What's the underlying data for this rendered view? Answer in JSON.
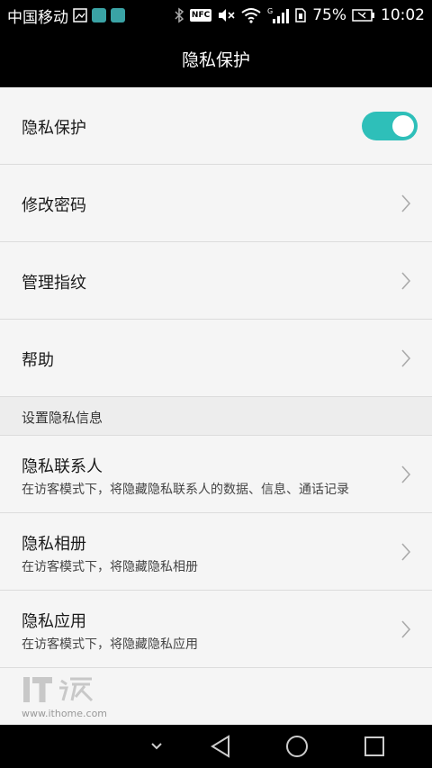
{
  "status_bar": {
    "carrier": "中国移动",
    "battery": "75%",
    "time": "10:02",
    "nfc": "NFC",
    "signal_type": "G"
  },
  "header": {
    "title": "隐私保护"
  },
  "rows": [
    {
      "title": "隐私保护",
      "control": "toggle",
      "toggle_on": true
    },
    {
      "title": "修改密码",
      "control": "chevron"
    },
    {
      "title": "管理指纹",
      "control": "chevron"
    },
    {
      "title": "帮助",
      "control": "chevron"
    }
  ],
  "section": {
    "title": "设置隐私信息"
  },
  "info_rows": [
    {
      "title": "隐私联系人",
      "subtitle": "在访客模式下，将隐藏隐私联系人的数据、信息、通话记录"
    },
    {
      "title": "隐私相册",
      "subtitle": "在访客模式下，将隐藏隐私相册"
    },
    {
      "title": "隐私应用",
      "subtitle": "在访客模式下，将隐藏隐私应用"
    }
  ],
  "watermark": {
    "logo": "IT之家",
    "url": "www.ithome.com"
  },
  "colors": {
    "accent": "#2ebfb9",
    "background": "#f5f5f5",
    "header_bg": "#000000"
  },
  "icons": {
    "nav_back": "back-triangle-icon",
    "nav_home": "home-circle-icon",
    "nav_recent": "recent-square-icon",
    "nav_hide": "chevron-down-icon"
  }
}
